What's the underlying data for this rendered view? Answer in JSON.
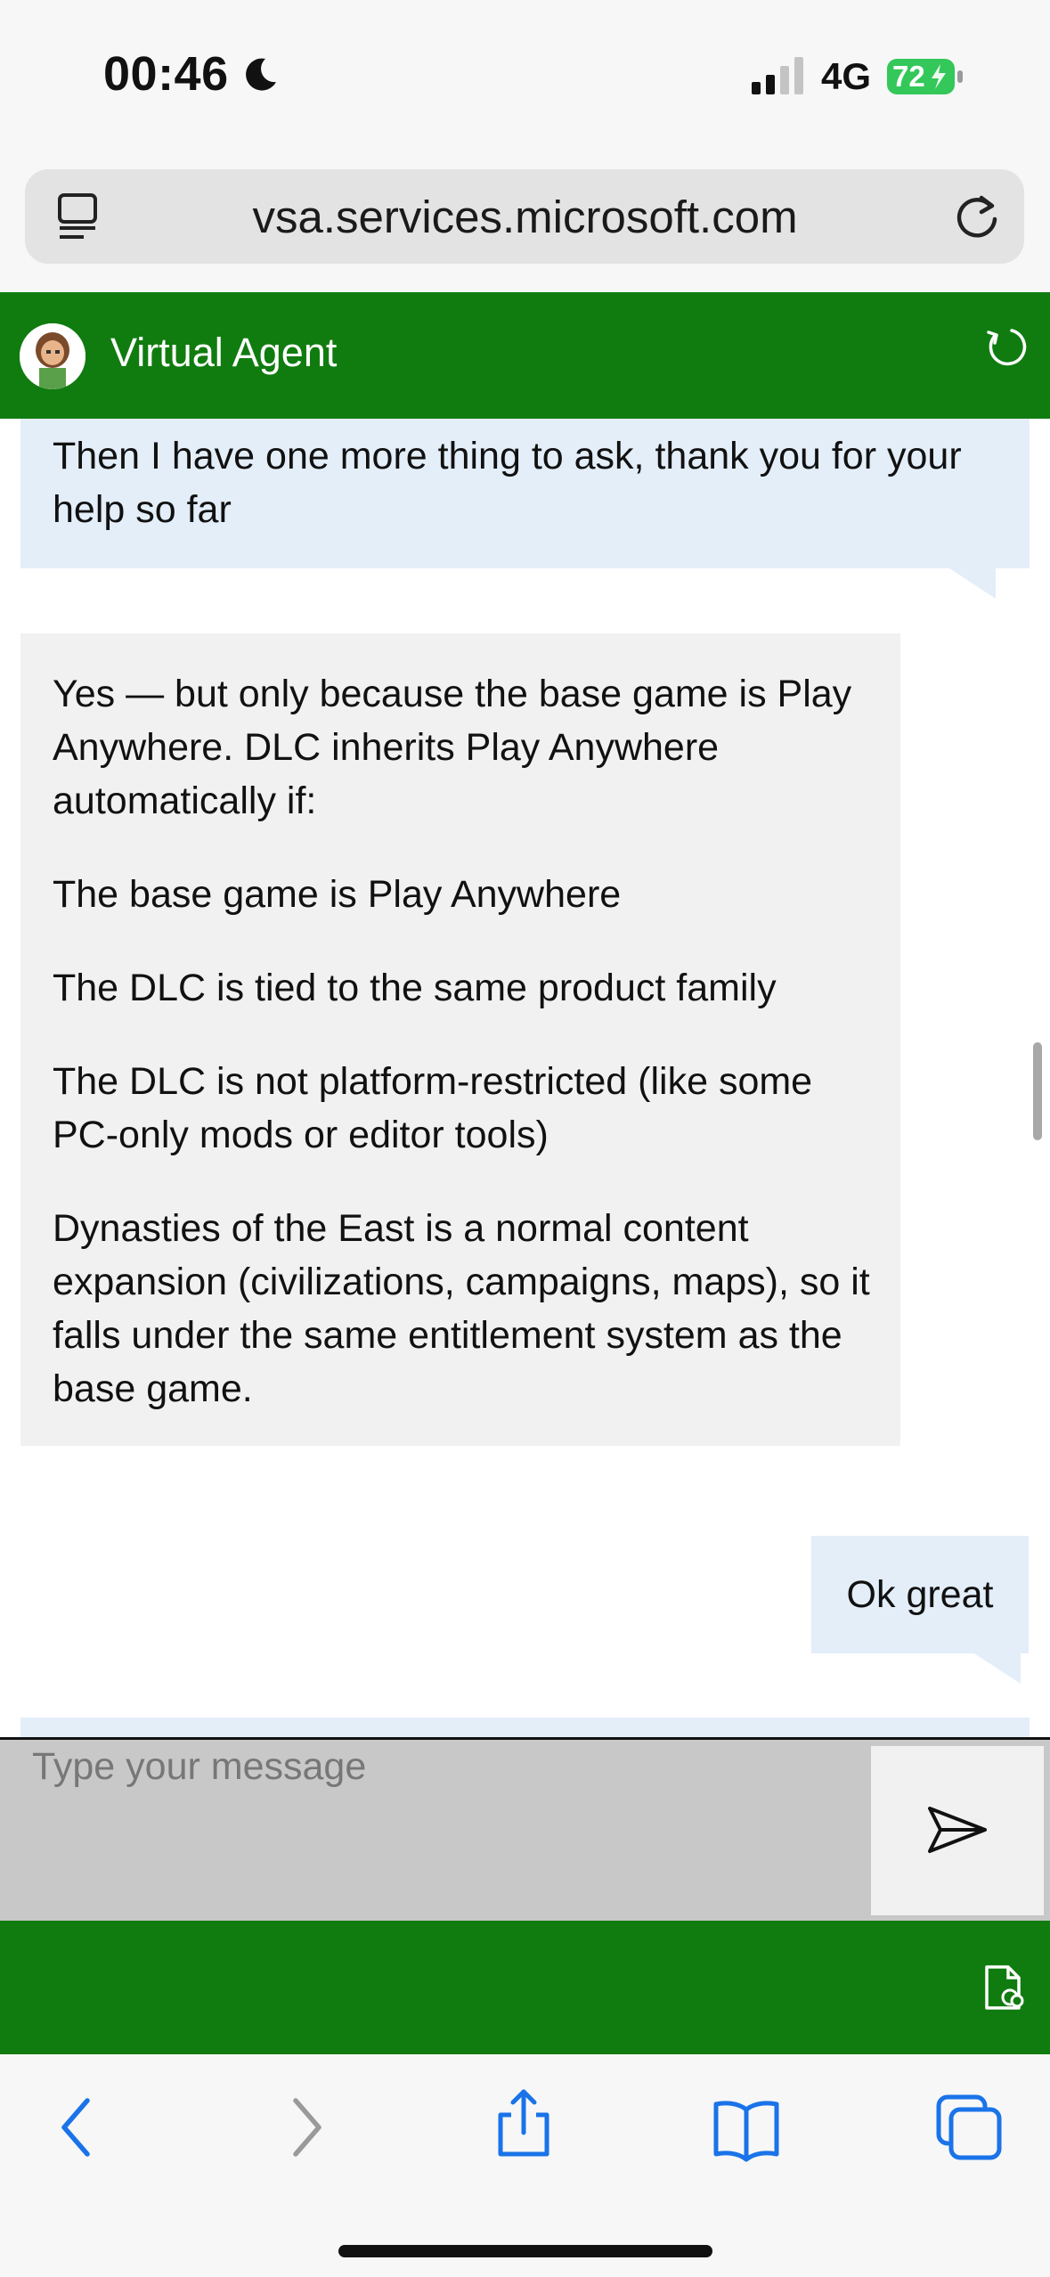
{
  "status_bar": {
    "time": "00:46",
    "network": "4G",
    "battery": "72",
    "battery_color": "#34c759",
    "icons": [
      "moon-icon",
      "signal-icon",
      "battery-icon"
    ]
  },
  "browser": {
    "url": "vsa.services.microsoft.com",
    "icons": [
      "url-menu-icon",
      "reload-icon"
    ]
  },
  "agent_header": {
    "title": "Virtual Agent",
    "background": "#107c10",
    "icons": [
      "avatar",
      "restart-icon"
    ]
  },
  "chat": {
    "messages": [
      {
        "sender": "user",
        "text": "Then I have one more thing to ask, thank you for your help so far"
      },
      {
        "sender": "agent",
        "paragraphs": [
          "Yes — but only because the base game is Play Anywhere. DLC inherits Play Anywhere automatically if:",
          "The base game is Play Anywhere",
          "The DLC is tied to the same product family",
          "The DLC is not platform-restricted (like some PC-only mods or editor tools)",
          "Dynasties of the East is a normal content expansion (civilizations, campaigns, maps), so it falls under the same entitlement system as the base game."
        ]
      },
      {
        "sender": "user",
        "text": "Ok great"
      }
    ],
    "user_bubble_color": "#e3eef9",
    "agent_bubble_color": "#f1f1f1"
  },
  "composer": {
    "placeholder": "Type your message",
    "value": "",
    "icons": [
      "send-icon"
    ]
  },
  "footer": {
    "icons": [
      "transcript-icon"
    ]
  },
  "browser_toolbar": {
    "icons": [
      "back-icon",
      "forward-icon",
      "share-icon",
      "bookmarks-icon",
      "tabs-icon"
    ],
    "accent": "#1a73e8"
  }
}
